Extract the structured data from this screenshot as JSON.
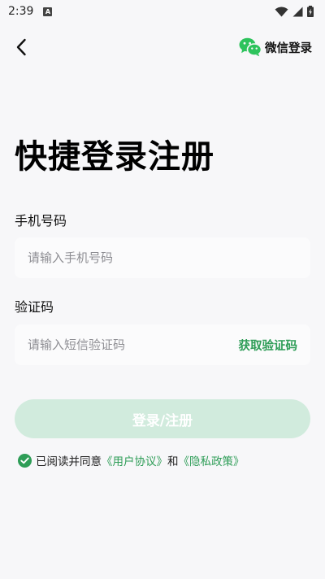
{
  "status_bar": {
    "time": "2:39",
    "notification_badge": "A",
    "icons": [
      "wifi-icon",
      "signal-icon",
      "battery-charging-icon"
    ]
  },
  "header": {
    "back_icon": "chevron-left-icon",
    "wechat_icon": "wechat-icon",
    "wechat_login_label": "微信登录"
  },
  "main": {
    "title": "快捷登录注册",
    "phone": {
      "label": "手机号码",
      "placeholder": "请输入手机号码",
      "value": ""
    },
    "code": {
      "label": "验证码",
      "placeholder": "请输入短信验证码",
      "value": "",
      "get_code_label": "获取验证码"
    },
    "submit_label": "登录/注册",
    "agreement": {
      "checked": true,
      "prefix": "已阅读并同意",
      "user_agreement": "《用户协议》",
      "conjunction": "和",
      "privacy_policy": "《隐私政策》"
    }
  },
  "colors": {
    "accent": "#2e9d57",
    "button_disabled_bg": "#d1ebdd",
    "background": "#f7f7f9"
  }
}
